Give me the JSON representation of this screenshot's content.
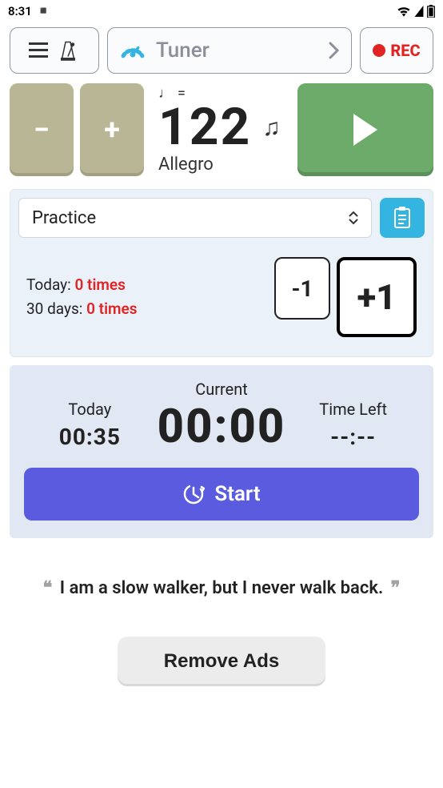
{
  "status": {
    "time": "8:31"
  },
  "top": {
    "tuner_label": "Tuner",
    "rec_label": "REC"
  },
  "tempo": {
    "minus": "−",
    "plus": "+",
    "note_equals": "=",
    "bpm": "122",
    "name": "Allegro"
  },
  "practice": {
    "select_label": "Practice",
    "today_label": "Today:",
    "today_value": "0 times",
    "days_label": "30 days:",
    "days_value": "0 times",
    "minus1": "-1",
    "plus1": "+1"
  },
  "timer": {
    "today_label": "Today",
    "today_value": "00:35",
    "current_label": "Current",
    "current_value": "00:00",
    "left_label": "Time Left",
    "left_value": "--:--",
    "start_label": "Start"
  },
  "quote": {
    "text": "I am a slow walker, but I never walk back."
  },
  "ads": {
    "remove_label": "Remove Ads"
  }
}
